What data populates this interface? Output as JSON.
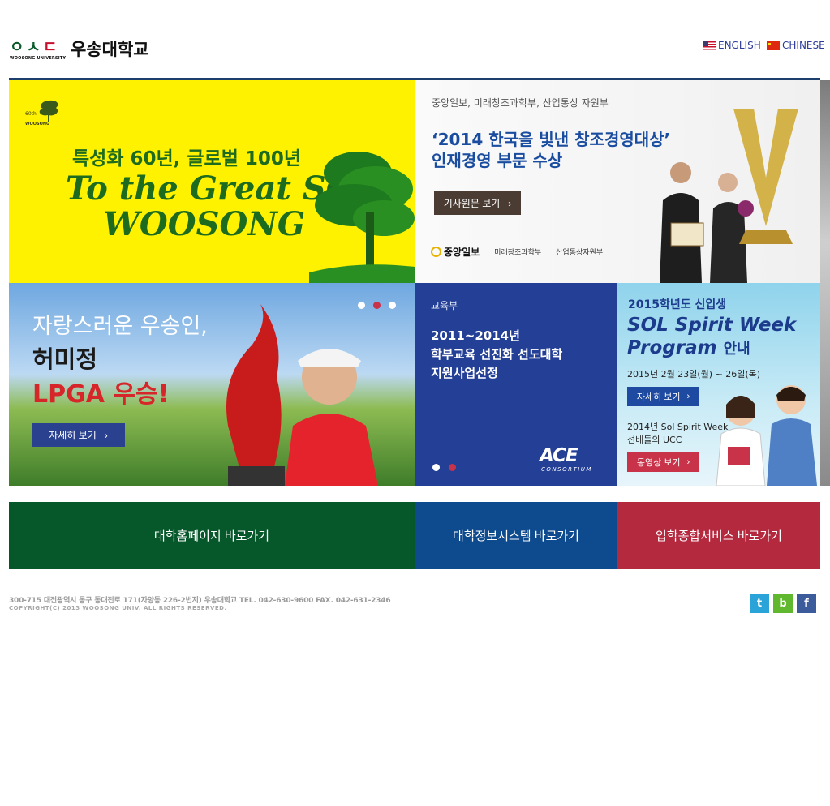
{
  "header": {
    "logo_glyph_1": "ㅇ",
    "logo_glyph_2": "ㅅ",
    "logo_glyph_3": "ㄷ",
    "logo_sub": "WOOSONG UNIVERSITY",
    "logo_name": "우송대학교",
    "lang_english": "ENGLISH",
    "lang_chinese": "CHINESE"
  },
  "banner_anniversary": {
    "badge_line1": "60th",
    "badge_line2": "WOOSONG",
    "headline": "특성화 60년, 글로벌 100년",
    "slogan_line1": "To the Great SOL",
    "slogan_line2": "WOOSONG"
  },
  "banner_award": {
    "sponsors": "중앙일보, 미래창조과학부, 산업통상 자원부",
    "title_line1": "‘2014 한국을 빛낸 창조경영대상’",
    "title_line2": "인재경영 부문 수상",
    "button_label": "기사원문 보기",
    "logo_joongang": "중앙일보",
    "logo_msip": "미래창조과학부",
    "logo_motie": "산업통상자원부"
  },
  "banner_golf": {
    "line1": "자랑스러운 우송인,",
    "line2": "허미정",
    "line3": "LPGA 우승!",
    "button_label": "자세히 보기"
  },
  "banner_ace": {
    "ministry": "교육부",
    "line1": "2011~2014년",
    "line2": "학부교육 선진화 선도대학",
    "line3": "지원사업선정",
    "ace_logo": "ACE",
    "ace_sub": "CONSORTIUM"
  },
  "banner_sol": {
    "line1": "2015학년도 신입생",
    "line2a": "SOL Spirit Week",
    "line2b": "Program",
    "line2c": "안내",
    "date": "2015년 2월 23일(월) ~ 26일(목)",
    "button_detail": "자세히 보기",
    "ucc_line1": "2014년 Sol Spirit Week",
    "ucc_line2": "선배들의 UCC",
    "button_video": "동영상 보기"
  },
  "nav": {
    "homepage": "대학홈페이지 바로가기",
    "info_system": "대학정보시스템 바로가기",
    "admission": "입학종합서비스 바로가기"
  },
  "footer": {
    "address": "300-715  대전광역시 동구 동대전로 171(자양동 226-2번지)  우송대학교  TEL. 042-630-9600  FAX. 042-631-2346",
    "copyright": "COPYRIGHT(C) 2013 WOOSONG UNIV. ALL RIGHTS RESERVED."
  },
  "social": {
    "twitter": "t",
    "blog": "b",
    "facebook": "f"
  },
  "colors": {
    "brand_green": "#06582a",
    "brand_blue": "#0e4a8e",
    "brand_red": "#b5293f",
    "banner_yellow": "#fff200",
    "ace_blue": "#233f96"
  },
  "icons": [
    "us-flag-icon",
    "cn-flag-icon",
    "chevron-right-icon",
    "twitter-icon",
    "blog-icon",
    "facebook-icon"
  ]
}
